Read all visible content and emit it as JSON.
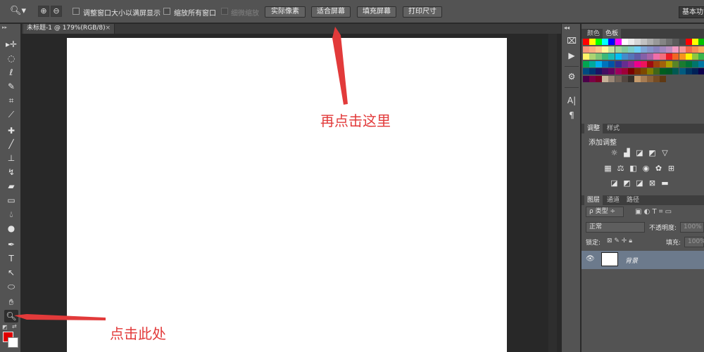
{
  "options_bar": {
    "checkbox_resize_windows": "调整窗口大小以满屏显示",
    "checkbox_zoom_all": "缩放所有窗口",
    "checkbox_scrubby_zoom": "细微缩放",
    "button_actual_pixels": "实际像素",
    "button_fit_screen": "适合屏幕",
    "button_fill_screen": "填充屏幕",
    "button_print_size": "打印尺寸",
    "workspace": "基本功能"
  },
  "document": {
    "tab_title": "未标题-1 @ 179%(RGB/8)",
    "tab_close": "×"
  },
  "panels": {
    "tab_color": "颜色",
    "tab_swatches": "色板",
    "tab_adjustments": "调整",
    "tab_styles": "样式",
    "adjustments_title": "添加调整",
    "tab_layers": "图层",
    "tab_channels": "通道",
    "tab_paths": "路径",
    "filter_kind": "类型",
    "blend_mode": "正常",
    "opacity_label": "不透明度:",
    "opacity_value": "100%",
    "lock_label": "锁定:",
    "fill_label": "填充:",
    "fill_value": "100%",
    "layer_name": "背景"
  },
  "annotations": {
    "click_here": "点击此处",
    "then_click_here": "再点击这里",
    "color": "#e23a3a"
  },
  "colors": {
    "foreground": "#e00000",
    "background": "#ffffff",
    "ui_panel": "#535353",
    "layer_selected": "#6c7a8c"
  }
}
